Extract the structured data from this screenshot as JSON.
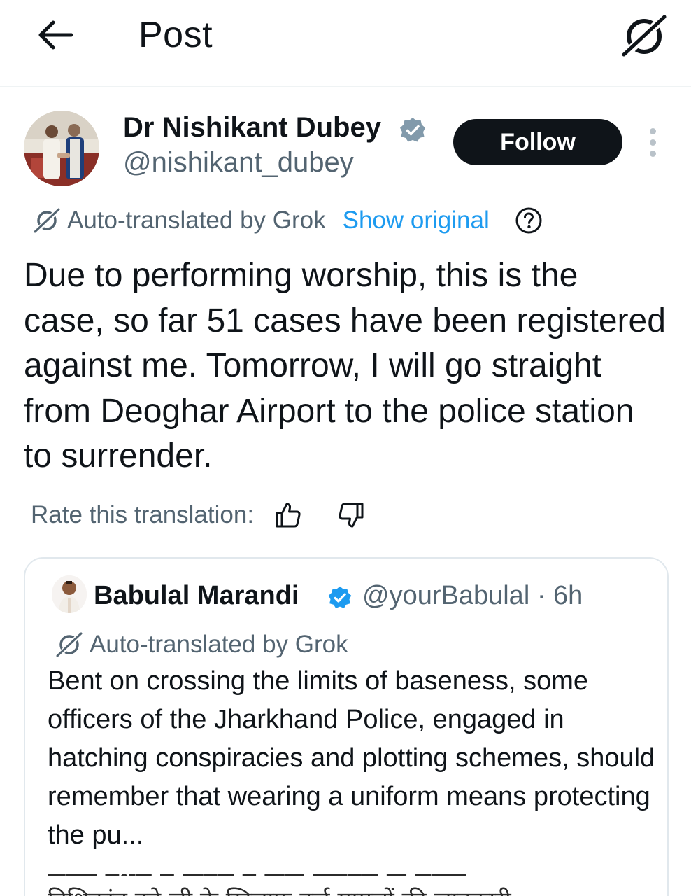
{
  "header": {
    "title": "Post",
    "back_icon": "arrow-left-icon",
    "grok_icon": "grok-logo-icon"
  },
  "post": {
    "author": {
      "name": "Dr Nishikant Dubey",
      "handle": "@nishikant_dubey",
      "verified": true,
      "verified_color": "#829aab"
    },
    "follow_label": "Follow",
    "translation": {
      "label": "Auto-translated by Grok",
      "show_original": "Show original"
    },
    "text": "Due to performing worship, this is the case, so far 51 cases have been registered against me. Tomorrow, I will go straight from Deoghar Airport to the police station to surrender.",
    "rate_label": "Rate this translation:"
  },
  "quoted": {
    "author": {
      "name": "Babulal Marandi",
      "handle": "@yourBabulal · 6h",
      "verified": true,
      "verified_color": "#1d9bf0"
    },
    "translation_label": "Auto-translated by Grok",
    "text": "Bent on crossing the limits of baseness, some officers of the Jharkhand Police, engaged in hatching conspiracies and plotting schemes, should remember that wearing a uniform means protecting the pu...",
    "cut_off_line_1": "जयरा प्रथरा प मानरा न गाड़ा राजपरा ना राराज",
    "cut_off_line_2": "निशिकांत दुबे जी के खिलाफ दर्ज मामलों की जानकारी"
  },
  "colors": {
    "text": "#0f1419",
    "secondary": "#536471",
    "link": "#1d9bf0",
    "follow_bg": "#0f1419",
    "follow_text": "#ffffff",
    "border": "#e1e8ed"
  }
}
